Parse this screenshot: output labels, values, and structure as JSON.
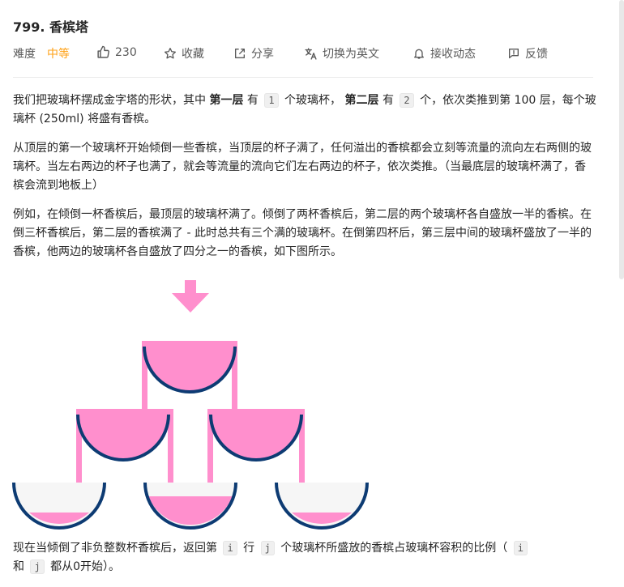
{
  "problem": {
    "title": "799. 香槟塔"
  },
  "meta": {
    "difficulty_label": "难度",
    "difficulty_value": "中等",
    "likes": "230",
    "favorite_label": "收藏",
    "share_label": "分享",
    "switch_lang_label": "切换为英文",
    "follow_label": "接收动态",
    "feedback_label": "反馈"
  },
  "content": {
    "p1": {
      "a": "我们把玻璃杯摆成金字塔的形状，其中 ",
      "b": "第一层",
      "c": " 有 ",
      "d": "1",
      "e": " 个玻璃杯， ",
      "f": "第二层",
      "g": " 有 ",
      "h": "2",
      "i": " 个，依次类推到第 100 层，每个玻璃杯 (250ml) 将盛有香槟。"
    },
    "p2": "从顶层的第一个玻璃杯开始倾倒一些香槟，当顶层的杯子满了，任何溢出的香槟都会立刻等流量的流向左右两侧的玻璃杯。当左右两边的杯子也满了，就会等流量的流向它们左右两边的杯子，依次类推。（当最底层的玻璃杯满了，香槟会流到地板上）",
    "p3": "例如，在倾倒一杯香槟后，最顶层的玻璃杯满了。倾倒了两杯香槟后，第二层的两个玻璃杯各自盛放一半的香槟。在倒三杯香槟后，第二层的香槟满了 - 此时总共有三个满的玻璃杯。在倒第四杯后，第三层中间的玻璃杯盛放了一半的香槟，他两边的玻璃杯各自盛放了四分之一的香槟，如下图所示。",
    "p4": {
      "a": "现在当倾倒了非负整数杯香槟后，返回第 ",
      "b": "i",
      "c": " 行 ",
      "d": "j",
      "e": " 个玻璃杯所盛放的香槟占玻璃杯容积的比例（ ",
      "f": "i",
      "g": " 和 ",
      "h": "j",
      "i": " 都从0开始）。"
    }
  },
  "figure": {
    "colors": {
      "champagne": "#ff8fcd",
      "glass_outline": "#0d3b73",
      "empty_glass": "#f6f6f6"
    },
    "glass_fill_levels": {
      "row0": [
        1
      ],
      "row1": [
        1,
        1
      ],
      "row2": [
        0.25,
        0.5,
        0.25
      ]
    }
  }
}
